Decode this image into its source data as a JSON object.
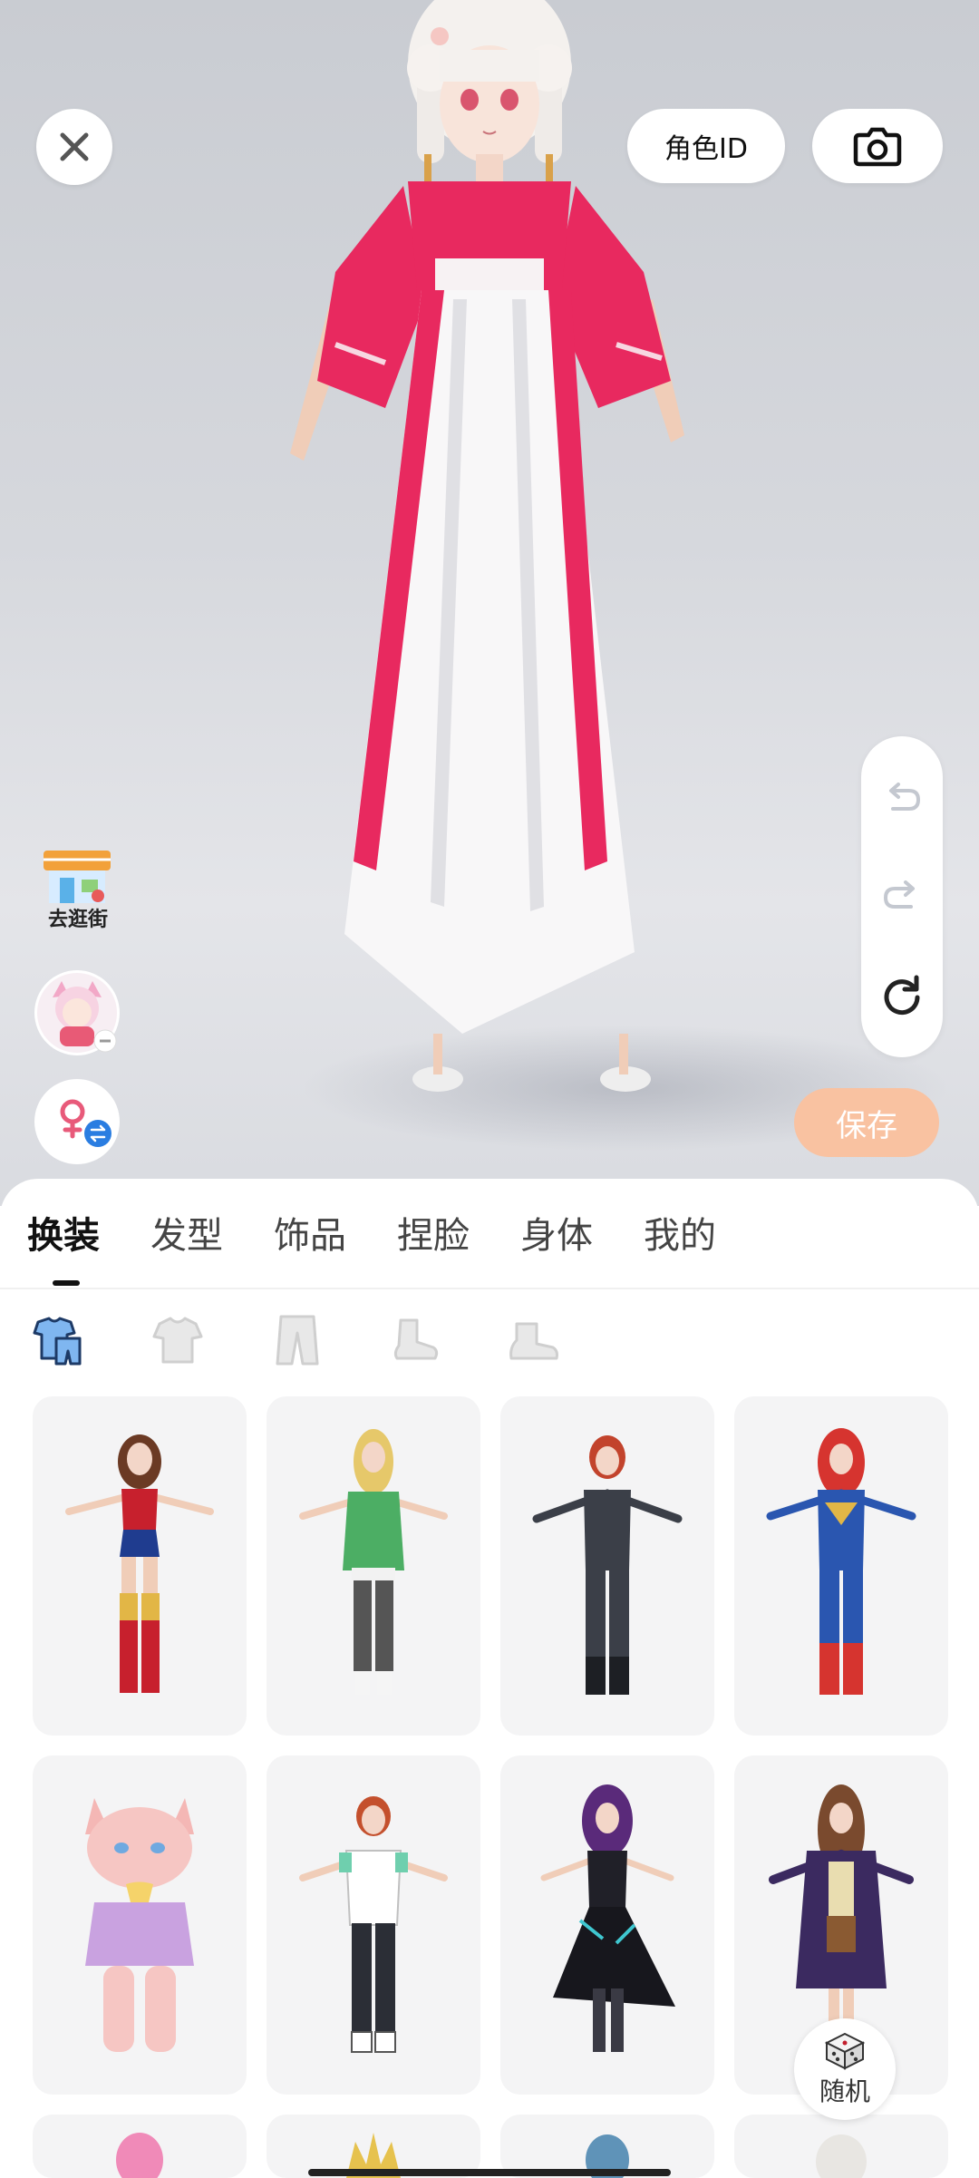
{
  "top_bar": {
    "close_icon": "close-icon",
    "role_id_label": "角色ID",
    "camera_icon": "camera-icon"
  },
  "left_tools": {
    "shop_label": "去逛街",
    "gender_switch_icon": "gender-switch-icon"
  },
  "right_tools": {
    "undo_icon": "undo-icon",
    "redo_icon": "redo-icon",
    "reset_icon": "reset-icon",
    "save_label": "保存"
  },
  "tabs": [
    {
      "label": "换装",
      "active": true
    },
    {
      "label": "发型",
      "active": false
    },
    {
      "label": "饰品",
      "active": false
    },
    {
      "label": "捏脸",
      "active": false
    },
    {
      "label": "身体",
      "active": false
    },
    {
      "label": "我的",
      "active": false
    }
  ],
  "subcategories": [
    {
      "icon": "full-outfit-icon",
      "active": true
    },
    {
      "icon": "top-shirt-icon",
      "active": false
    },
    {
      "icon": "pants-icon",
      "active": false
    },
    {
      "icon": "socks-icon",
      "active": false
    },
    {
      "icon": "shoes-icon",
      "active": false
    }
  ],
  "outfits": [
    {
      "name": "red-gold-hero-outfit"
    },
    {
      "name": "green-ninja-outfit"
    },
    {
      "name": "black-tactical-outfit"
    },
    {
      "name": "blue-red-hero-outfit"
    },
    {
      "name": "pink-cat-costume"
    },
    {
      "name": "white-tee-joggers-outfit"
    },
    {
      "name": "gothic-black-dress"
    },
    {
      "name": "purple-robe-uniform"
    }
  ],
  "random_label": "随机",
  "colors": {
    "accent_save": "#f9c2a1",
    "robe_red": "#e8295f",
    "card_bg": "#f4f4f5"
  }
}
